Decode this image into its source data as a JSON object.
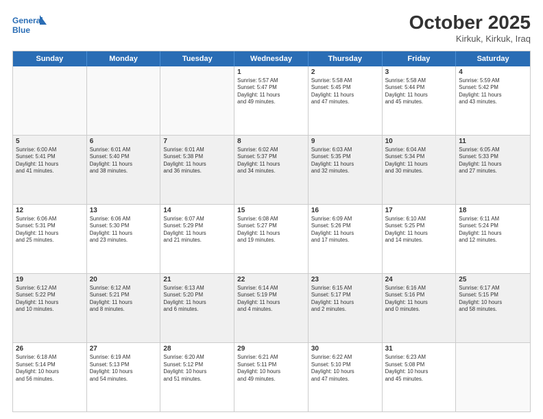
{
  "header": {
    "logo_line1": "General",
    "logo_line2": "Blue",
    "month": "October 2025",
    "location": "Kirkuk, Kirkuk, Iraq"
  },
  "days_of_week": [
    "Sunday",
    "Monday",
    "Tuesday",
    "Wednesday",
    "Thursday",
    "Friday",
    "Saturday"
  ],
  "weeks": [
    [
      {
        "day": "",
        "info": ""
      },
      {
        "day": "",
        "info": ""
      },
      {
        "day": "",
        "info": ""
      },
      {
        "day": "1",
        "info": "Sunrise: 5:57 AM\nSunset: 5:47 PM\nDaylight: 11 hours\nand 49 minutes."
      },
      {
        "day": "2",
        "info": "Sunrise: 5:58 AM\nSunset: 5:45 PM\nDaylight: 11 hours\nand 47 minutes."
      },
      {
        "day": "3",
        "info": "Sunrise: 5:58 AM\nSunset: 5:44 PM\nDaylight: 11 hours\nand 45 minutes."
      },
      {
        "day": "4",
        "info": "Sunrise: 5:59 AM\nSunset: 5:42 PM\nDaylight: 11 hours\nand 43 minutes."
      }
    ],
    [
      {
        "day": "5",
        "info": "Sunrise: 6:00 AM\nSunset: 5:41 PM\nDaylight: 11 hours\nand 41 minutes."
      },
      {
        "day": "6",
        "info": "Sunrise: 6:01 AM\nSunset: 5:40 PM\nDaylight: 11 hours\nand 38 minutes."
      },
      {
        "day": "7",
        "info": "Sunrise: 6:01 AM\nSunset: 5:38 PM\nDaylight: 11 hours\nand 36 minutes."
      },
      {
        "day": "8",
        "info": "Sunrise: 6:02 AM\nSunset: 5:37 PM\nDaylight: 11 hours\nand 34 minutes."
      },
      {
        "day": "9",
        "info": "Sunrise: 6:03 AM\nSunset: 5:35 PM\nDaylight: 11 hours\nand 32 minutes."
      },
      {
        "day": "10",
        "info": "Sunrise: 6:04 AM\nSunset: 5:34 PM\nDaylight: 11 hours\nand 30 minutes."
      },
      {
        "day": "11",
        "info": "Sunrise: 6:05 AM\nSunset: 5:33 PM\nDaylight: 11 hours\nand 27 minutes."
      }
    ],
    [
      {
        "day": "12",
        "info": "Sunrise: 6:06 AM\nSunset: 5:31 PM\nDaylight: 11 hours\nand 25 minutes."
      },
      {
        "day": "13",
        "info": "Sunrise: 6:06 AM\nSunset: 5:30 PM\nDaylight: 11 hours\nand 23 minutes."
      },
      {
        "day": "14",
        "info": "Sunrise: 6:07 AM\nSunset: 5:29 PM\nDaylight: 11 hours\nand 21 minutes."
      },
      {
        "day": "15",
        "info": "Sunrise: 6:08 AM\nSunset: 5:27 PM\nDaylight: 11 hours\nand 19 minutes."
      },
      {
        "day": "16",
        "info": "Sunrise: 6:09 AM\nSunset: 5:26 PM\nDaylight: 11 hours\nand 17 minutes."
      },
      {
        "day": "17",
        "info": "Sunrise: 6:10 AM\nSunset: 5:25 PM\nDaylight: 11 hours\nand 14 minutes."
      },
      {
        "day": "18",
        "info": "Sunrise: 6:11 AM\nSunset: 5:24 PM\nDaylight: 11 hours\nand 12 minutes."
      }
    ],
    [
      {
        "day": "19",
        "info": "Sunrise: 6:12 AM\nSunset: 5:22 PM\nDaylight: 11 hours\nand 10 minutes."
      },
      {
        "day": "20",
        "info": "Sunrise: 6:12 AM\nSunset: 5:21 PM\nDaylight: 11 hours\nand 8 minutes."
      },
      {
        "day": "21",
        "info": "Sunrise: 6:13 AM\nSunset: 5:20 PM\nDaylight: 11 hours\nand 6 minutes."
      },
      {
        "day": "22",
        "info": "Sunrise: 6:14 AM\nSunset: 5:19 PM\nDaylight: 11 hours\nand 4 minutes."
      },
      {
        "day": "23",
        "info": "Sunrise: 6:15 AM\nSunset: 5:17 PM\nDaylight: 11 hours\nand 2 minutes."
      },
      {
        "day": "24",
        "info": "Sunrise: 6:16 AM\nSunset: 5:16 PM\nDaylight: 11 hours\nand 0 minutes."
      },
      {
        "day": "25",
        "info": "Sunrise: 6:17 AM\nSunset: 5:15 PM\nDaylight: 10 hours\nand 58 minutes."
      }
    ],
    [
      {
        "day": "26",
        "info": "Sunrise: 6:18 AM\nSunset: 5:14 PM\nDaylight: 10 hours\nand 56 minutes."
      },
      {
        "day": "27",
        "info": "Sunrise: 6:19 AM\nSunset: 5:13 PM\nDaylight: 10 hours\nand 54 minutes."
      },
      {
        "day": "28",
        "info": "Sunrise: 6:20 AM\nSunset: 5:12 PM\nDaylight: 10 hours\nand 51 minutes."
      },
      {
        "day": "29",
        "info": "Sunrise: 6:21 AM\nSunset: 5:11 PM\nDaylight: 10 hours\nand 49 minutes."
      },
      {
        "day": "30",
        "info": "Sunrise: 6:22 AM\nSunset: 5:10 PM\nDaylight: 10 hours\nand 47 minutes."
      },
      {
        "day": "31",
        "info": "Sunrise: 6:23 AM\nSunset: 5:08 PM\nDaylight: 10 hours\nand 45 minutes."
      },
      {
        "day": "",
        "info": ""
      }
    ]
  ]
}
